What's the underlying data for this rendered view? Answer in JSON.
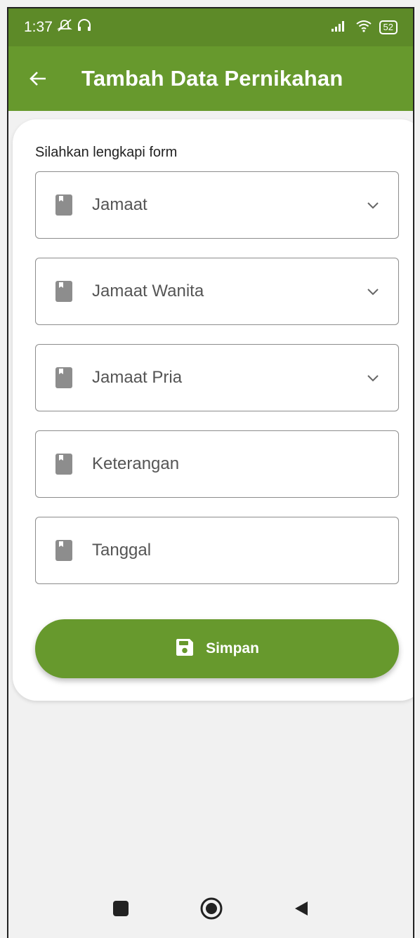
{
  "status_bar": {
    "time": "1:37",
    "battery": "52",
    "icons": [
      "muted-notification-icon",
      "headset-icon",
      "signal-icon",
      "wifi-icon",
      "battery-icon"
    ]
  },
  "app_bar": {
    "title": "Tambah Data Pernikahan",
    "back_icon": "arrow-left-icon",
    "color": "#67992d",
    "status_color": "#5d8a28"
  },
  "form": {
    "instruction": "Silahkan lengkapi form",
    "fields": [
      {
        "label": "Jamaat",
        "type": "dropdown",
        "icon": "book-icon"
      },
      {
        "label": "Jamaat Wanita",
        "type": "dropdown",
        "icon": "book-icon"
      },
      {
        "label": "Jamaat Pria",
        "type": "dropdown",
        "icon": "book-icon"
      },
      {
        "label": "Keterangan",
        "type": "text",
        "icon": "book-icon"
      },
      {
        "label": "Tanggal",
        "type": "date",
        "icon": "book-icon"
      }
    ],
    "save_button": {
      "label": "Simpan",
      "icon": "save-icon"
    }
  },
  "nav_bar": {
    "icons": [
      "recents-icon",
      "home-icon",
      "back-triangle-icon"
    ]
  }
}
